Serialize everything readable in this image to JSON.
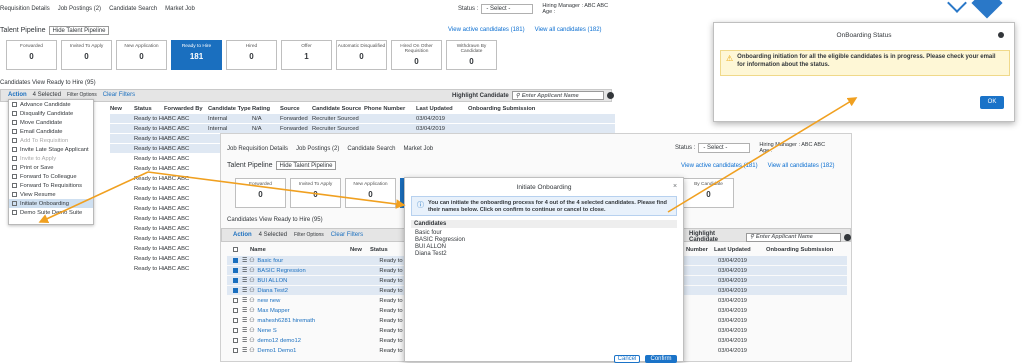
{
  "colors": {
    "accent": "#1a6fbf",
    "arrow": "#f0a020",
    "warning": "#fef7d6",
    "link": "#0a6ed1"
  },
  "back": {
    "toolbar": {
      "req_details": "Requisition Details",
      "job_postings": "Job Postings (2)",
      "candidate_search": "Candidate Search",
      "market_job": "Market Job"
    },
    "status_label": "Status :",
    "status_value": "- Select -",
    "hiring_manager": "Hiring Manager : ABC ABC",
    "age": "Age :",
    "pipeline_label": "Talent Pipeline",
    "pipeline_select": "Hide Talent Pipeline",
    "links": {
      "active": "View active candidates (181)",
      "all": "View all candidates (182)"
    },
    "stages": [
      {
        "label": "Forwarded",
        "count": "0"
      },
      {
        "label": "Invited To Apply",
        "count": "0"
      },
      {
        "label": "New Application",
        "count": "0"
      },
      {
        "label": "Ready to Hire",
        "count": "181"
      },
      {
        "label": "Hired",
        "count": "0"
      },
      {
        "label": "Offer",
        "count": "1"
      },
      {
        "label": "Automatic Disqualified",
        "count": "0"
      },
      {
        "label": "Hired On Other Requisition",
        "count": "0"
      },
      {
        "label": "Withdrawn By Candidate",
        "count": "0"
      }
    ],
    "grid_title": "Candidates View Ready to Hire (95)",
    "action_label": "Action",
    "selected_label": "4 Selected",
    "filter_options": "Filter Options",
    "clear_filters": "Clear Filters",
    "highlight_label": "Highlight Candidate",
    "highlight_placeholder": "Enter Applicant Name",
    "columns": [
      "New",
      "Status",
      "Forwarded By",
      "Candidate Type",
      "Rating",
      "Source",
      "Candidate Source",
      "Phone Number",
      "Last Updated",
      "Onboarding Submission"
    ],
    "rows": [
      {
        "status": "Ready to Hire",
        "fwd": "ABC ABC",
        "type": "Internal",
        "rating": "N/A",
        "source": "Forwarded",
        "csource": "Recruiter Sourced",
        "updated": "03/04/2019"
      },
      {
        "status": "Ready to Hire",
        "fwd": "ABC ABC",
        "type": "Internal",
        "rating": "N/A",
        "source": "Forwarded",
        "csource": "Recruiter Sourced",
        "updated": "03/04/2019"
      },
      {
        "status": "Ready to Hire",
        "fwd": "ABC ABC",
        "type": "",
        "rating": "",
        "source": "",
        "csource": "",
        "updated": ""
      },
      {
        "status": "Ready to Hire",
        "fwd": "ABC ABC",
        "type": "",
        "rating": "",
        "source": "",
        "csource": "",
        "updated": ""
      },
      {
        "status": "Ready to Hire",
        "fwd": "ABC ABC",
        "type": "",
        "rating": "",
        "source": "",
        "csource": "",
        "updated": ""
      },
      {
        "status": "Ready to Hire",
        "fwd": "ABC ABC",
        "type": "",
        "rating": "",
        "source": "",
        "csource": "",
        "updated": ""
      },
      {
        "status": "Ready to Hire",
        "fwd": "ABC ABC",
        "type": "",
        "rating": "",
        "source": "",
        "csource": "",
        "updated": ""
      },
      {
        "status": "Ready to Hire",
        "fwd": "ABC ABC",
        "type": "",
        "rating": "",
        "source": "",
        "csource": "",
        "updated": ""
      },
      {
        "status": "Ready to Hire",
        "fwd": "ABC ABC",
        "type": "",
        "rating": "",
        "source": "",
        "csource": "",
        "updated": ""
      },
      {
        "status": "Ready to Hire",
        "fwd": "ABC ABC",
        "type": "",
        "rating": "",
        "source": "",
        "csource": "",
        "updated": ""
      },
      {
        "status": "Ready to Hire",
        "fwd": "ABC ABC",
        "type": "",
        "rating": "",
        "source": "",
        "csource": "",
        "updated": ""
      },
      {
        "status": "Ready to Hire",
        "fwd": "ABC ABC",
        "type": "",
        "rating": "",
        "source": "",
        "csource": "",
        "updated": ""
      },
      {
        "status": "Ready to Hire",
        "fwd": "ABC ABC",
        "type": "",
        "rating": "",
        "source": "",
        "csource": "",
        "updated": ""
      },
      {
        "status": "Ready to Hire",
        "fwd": "ABC ABC",
        "type": "",
        "rating": "",
        "source": "",
        "csource": "",
        "updated": ""
      },
      {
        "status": "Ready to Hire",
        "fwd": "ABC ABC",
        "type": "",
        "rating": "",
        "source": "",
        "csource": "",
        "updated": ""
      },
      {
        "status": "Ready to Hire",
        "fwd": "ABC ABC",
        "type": "",
        "rating": "",
        "source": "",
        "csource": "",
        "updated": ""
      }
    ],
    "menu": [
      {
        "label": "Advance Candidate",
        "dim": false,
        "sel": false
      },
      {
        "label": "Disqualify Candidate",
        "dim": false,
        "sel": false
      },
      {
        "label": "Move Candidate",
        "dim": false,
        "sel": false
      },
      {
        "label": "Email Candidate",
        "dim": false,
        "sel": false
      },
      {
        "label": "Add To Requisition",
        "dim": true,
        "sel": false
      },
      {
        "label": "Invite Late Stage Applicant",
        "dim": false,
        "sel": false
      },
      {
        "label": "Invite to Apply",
        "dim": true,
        "sel": false
      },
      {
        "label": "Print or Save",
        "dim": false,
        "sel": false
      },
      {
        "label": "Forward To Colleague",
        "dim": false,
        "sel": false
      },
      {
        "label": "Forward To Requisitions",
        "dim": false,
        "sel": false
      },
      {
        "label": "View Resume",
        "dim": false,
        "sel": false
      },
      {
        "label": "Initiate Onboarding",
        "dim": false,
        "sel": true
      },
      {
        "label": "Demo Suite Demo Suite",
        "dim": false,
        "sel": false
      }
    ]
  },
  "front": {
    "toolbar": {
      "req_details": "Job Requisition Details",
      "job_postings": "Job Postings (2)",
      "candidate_search": "Candidate Search",
      "market_job": "Market Job"
    },
    "status_label": "Status :",
    "status_value": "- Select -",
    "hiring_manager": "Hiring Manager : ABC ABC",
    "age": "Age :",
    "pipeline_label": "Talent Pipeline",
    "pipeline_select": "Hide Talent Pipeline",
    "links": {
      "active": "View active candidates (181)",
      "all": "View all candidates (182)"
    },
    "stages": [
      {
        "label": "Forwarded",
        "count": "0"
      },
      {
        "label": "Invited To Apply",
        "count": "0"
      },
      {
        "label": "New Application",
        "count": "0"
      },
      {
        "label": "Ready",
        "count": "1"
      }
    ],
    "stage_right": {
      "label": "By Candidate",
      "count": "0"
    },
    "grid_title": "Candidates View Ready to Hire (95)",
    "action_label": "Action",
    "selected_label": "4 Selected",
    "filter_options": "Filter Options",
    "clear_filters": "Clear Filters",
    "highlight_label": "Highlight Candidate",
    "highlight_placeholder": "Enter Applicant Name",
    "columns": [
      "Name",
      "New",
      "Status"
    ],
    "right_columns": [
      "Number",
      "Last Updated",
      "Onboarding Submission"
    ],
    "rows": [
      {
        "name": "Basic four",
        "checked": true,
        "status": "Ready to",
        "updated": "03/04/2019"
      },
      {
        "name": "BASIC Regression",
        "checked": true,
        "status": "Ready to",
        "updated": "03/04/2019"
      },
      {
        "name": "BUI ALLON",
        "checked": true,
        "status": "Ready to",
        "updated": "03/04/2019"
      },
      {
        "name": "Diana Test2",
        "checked": true,
        "status": "Ready to",
        "updated": "03/04/2019"
      },
      {
        "name": "new new",
        "checked": false,
        "status": "Ready to",
        "updated": "03/04/2019"
      },
      {
        "name": "Max Mapper",
        "checked": false,
        "status": "Ready to",
        "updated": "03/04/2019"
      },
      {
        "name": "mahesh6281 hiremath",
        "checked": false,
        "status": "Ready to",
        "updated": "03/04/2019"
      },
      {
        "name": "Nene S",
        "checked": false,
        "status": "Ready to",
        "updated": "03/04/2019"
      },
      {
        "name": "demo12 demo12",
        "checked": false,
        "status": "Ready to",
        "updated": "03/04/2019"
      },
      {
        "name": "Demo1 Demo1",
        "checked": false,
        "status": "Ready to",
        "updated": "03/04/2019"
      }
    ]
  },
  "initiate_modal": {
    "title": "Initiate Onboarding",
    "info": "You can initiate the onboarding process for 4 out of the 4 selected candidates. Please find their names below. Click on confirm to continue or cancel to close.",
    "list_header": "Candidates",
    "candidates": [
      "Basic four",
      "BASIC Regression",
      "BUI ALLON",
      "Diana Test2"
    ],
    "cancel": "Cancel",
    "confirm": "Confirm"
  },
  "status_modal": {
    "title": "OnBoarding Status",
    "message": "Onboarding initiation for all the eligible candidates is in progress. Please check your email for information about the status.",
    "ok": "OK"
  }
}
